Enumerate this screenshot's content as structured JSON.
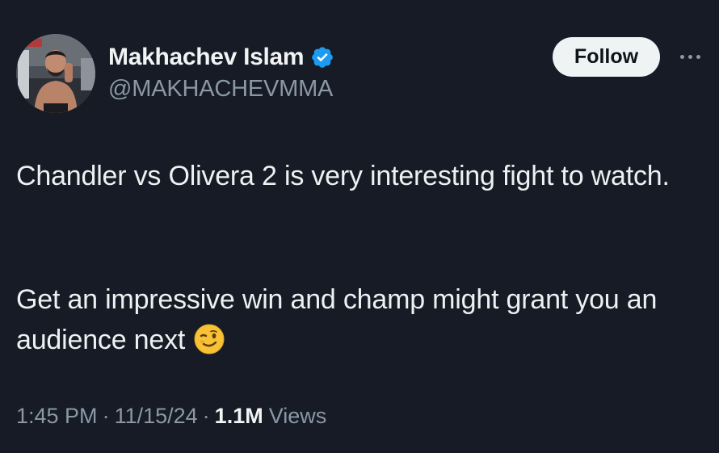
{
  "author": {
    "display_name": "Makhachev Islam",
    "handle": "@MAKHACHEVMMA",
    "verified": true,
    "avatar_icon": "fighter-portrait"
  },
  "actions": {
    "follow_label": "Follow",
    "more_icon": "more-options-icon"
  },
  "tweet": {
    "paragraph_1": "Chandler vs Olivera 2 is very interesting fight to watch.",
    "paragraph_2": "Get an impressive win and champ might grant you an audience next",
    "emoji": "winking-face-emoji"
  },
  "meta": {
    "time": "1:45 PM",
    "separator": "·",
    "date": "11/15/24",
    "views_count": "1.1M",
    "views_label": "Views"
  },
  "colors": {
    "background": "#161b26",
    "text_primary": "#e7e9ea",
    "text_secondary": "#8b98a5",
    "verified_blue": "#1d9bf0",
    "follow_bg": "#eff3f4"
  }
}
